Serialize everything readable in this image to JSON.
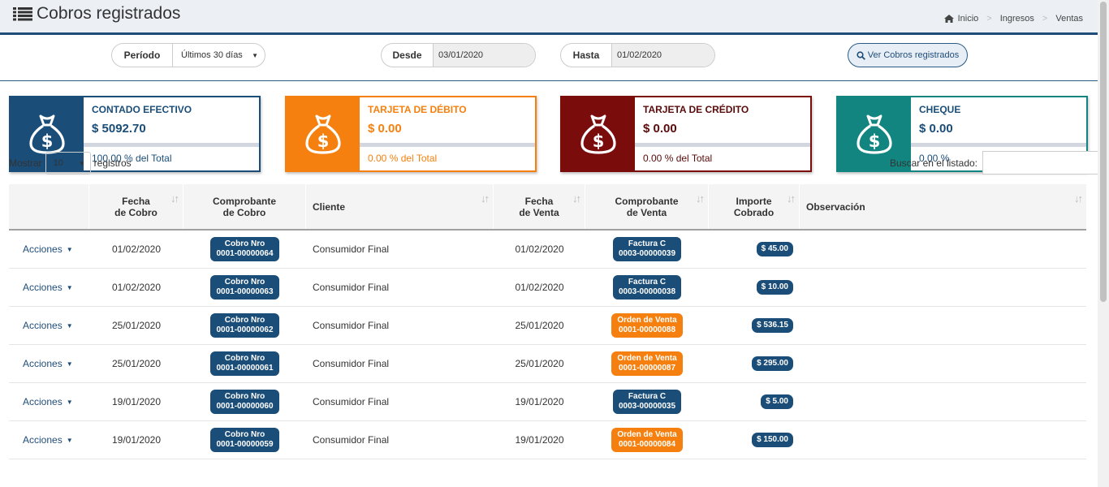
{
  "header": {
    "title": "Cobros registrados",
    "breadcrumb": [
      "Inicio",
      "Ingresos",
      "Ventas"
    ]
  },
  "filters": {
    "periodo_label": "Período",
    "periodo_value": "Últimos 30 días",
    "desde_label": "Desde",
    "desde_value": "03/01/2020",
    "hasta_label": "Hasta",
    "hasta_value": "01/02/2020",
    "ver_button": "Ver Cobros registrados"
  },
  "cards": [
    {
      "name": "CONTADO EFECTIVO",
      "amount": "$ 5092.70",
      "percent": "100.00 % del Total",
      "color": "#1a4d78",
      "text_color": "#1a4d78"
    },
    {
      "name": "TARJETA DE DÉBITO",
      "amount": "$ 0.00",
      "percent": "0.00 % del Total",
      "color": "#f5800f",
      "text_color": "#f5800f"
    },
    {
      "name": "TARJETA DE CRÉDITO",
      "amount": "$ 0.00",
      "percent": "0.00 % del Total",
      "color": "#7a0c0c",
      "text_color": "#5a0b0b"
    },
    {
      "name": "CHEQUE",
      "amount": "$ 0.00",
      "percent": "0.00 %",
      "color": "#138580",
      "text_color": "#1a4d78"
    }
  ],
  "table_controls": {
    "mostrar": "Mostrar",
    "page_size": "10",
    "registros": "registros",
    "buscar": "Buscar en el listado:"
  },
  "table": {
    "headers": {
      "fecha_cobro": [
        "Fecha",
        "de Cobro"
      ],
      "comprobante_cobro": [
        "Comprobante",
        "de Cobro"
      ],
      "cliente": "Cliente",
      "fecha_venta": [
        "Fecha",
        "de Venta"
      ],
      "comprobante_venta": [
        "Comprobante",
        "de Venta"
      ],
      "importe": [
        "Importe",
        "Cobrado"
      ],
      "observacion": "Observación"
    },
    "rows": [
      {
        "acciones": "Acciones",
        "fecha_cobro": "01/02/2020",
        "cobro": [
          "Cobro Nro",
          "0001-00000064"
        ],
        "cliente": "Consumidor Final",
        "fecha_venta": "01/02/2020",
        "venta": [
          "Factura C",
          "0003-00000039"
        ],
        "venta_color": "blue",
        "importe": "$ 45.00",
        "observacion": ""
      },
      {
        "acciones": "Acciones",
        "fecha_cobro": "01/02/2020",
        "cobro": [
          "Cobro Nro",
          "0001-00000063"
        ],
        "cliente": "Consumidor Final",
        "fecha_venta": "01/02/2020",
        "venta": [
          "Factura C",
          "0003-00000038"
        ],
        "venta_color": "blue",
        "importe": "$ 10.00",
        "observacion": ""
      },
      {
        "acciones": "Acciones",
        "fecha_cobro": "25/01/2020",
        "cobro": [
          "Cobro Nro",
          "0001-00000062"
        ],
        "cliente": "Consumidor Final",
        "fecha_venta": "25/01/2020",
        "venta": [
          "Orden de Venta",
          "0001-00000088"
        ],
        "venta_color": "orange",
        "importe": "$ 536.15",
        "observacion": ""
      },
      {
        "acciones": "Acciones",
        "fecha_cobro": "25/01/2020",
        "cobro": [
          "Cobro Nro",
          "0001-00000061"
        ],
        "cliente": "Consumidor Final",
        "fecha_venta": "25/01/2020",
        "venta": [
          "Orden de Venta",
          "0001-00000087"
        ],
        "venta_color": "orange",
        "importe": "$ 295.00",
        "observacion": ""
      },
      {
        "acciones": "Acciones",
        "fecha_cobro": "19/01/2020",
        "cobro": [
          "Cobro Nro",
          "0001-00000060"
        ],
        "cliente": "Consumidor Final",
        "fecha_venta": "19/01/2020",
        "venta": [
          "Factura C",
          "0003-00000035"
        ],
        "venta_color": "blue",
        "importe": "$ 5.00",
        "observacion": ""
      },
      {
        "acciones": "Acciones",
        "fecha_cobro": "19/01/2020",
        "cobro": [
          "Cobro Nro",
          "0001-00000059"
        ],
        "cliente": "Consumidor Final",
        "fecha_venta": "19/01/2020",
        "venta": [
          "Orden de Venta",
          "0001-00000084"
        ],
        "venta_color": "orange",
        "importe": "$ 150.00",
        "observacion": ""
      }
    ]
  }
}
